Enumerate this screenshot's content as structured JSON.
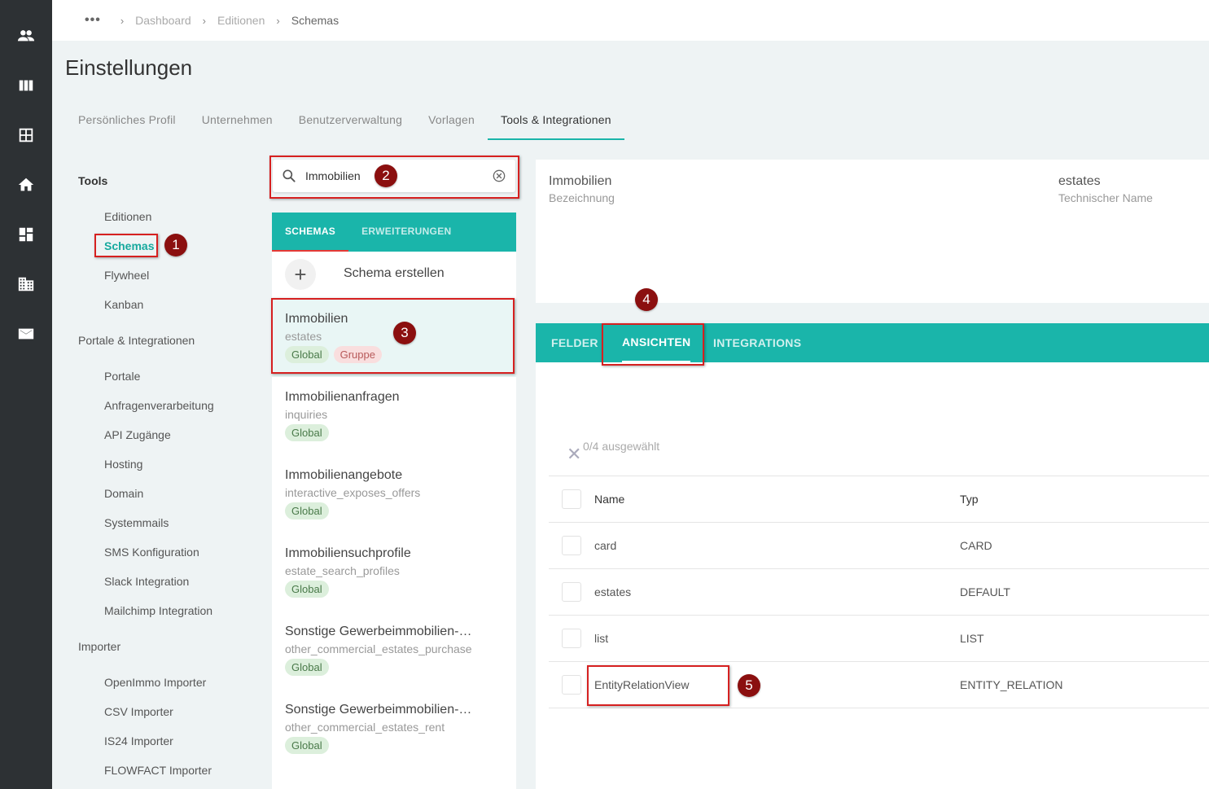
{
  "breadcrumb": {
    "more": "•••",
    "items": [
      "Dashboard",
      "Editionen",
      "Schemas"
    ]
  },
  "page_title": "Einstellungen",
  "main_tabs": [
    {
      "label": "Persönliches Profil"
    },
    {
      "label": "Unternehmen"
    },
    {
      "label": "Benutzerverwaltung"
    },
    {
      "label": "Vorlagen"
    },
    {
      "label": "Tools & Integrationen",
      "active": true
    }
  ],
  "rail_icons": [
    "users-icon",
    "columns-icon",
    "grid-icon",
    "home-icon",
    "dashboard-icon",
    "building-icon",
    "mail-icon"
  ],
  "tools_nav": {
    "tools_heading": "Tools",
    "tools_items": [
      "Editionen",
      "Schemas",
      "Flywheel",
      "Kanban"
    ],
    "portale_heading": "Portale & Integrationen",
    "portale_items": [
      "Portale",
      "Anfragenverarbeitung",
      "API Zugänge",
      "Hosting",
      "Domain",
      "Systemmails",
      "SMS Konfiguration",
      "Slack Integration",
      "Mailchimp Integration"
    ],
    "importer_heading": "Importer",
    "importer_items": [
      "OpenImmo Importer",
      "CSV Importer",
      "IS24 Importer",
      "FLOWFACT Importer"
    ]
  },
  "search": {
    "value": "Immobilien"
  },
  "list_tabs": {
    "schemas": "SCHEMAS",
    "erweiterungen": "ERWEITERUNGEN"
  },
  "create_schema_label": "Schema erstellen",
  "schemas": [
    {
      "name": "Immobilien",
      "tech": "estates",
      "chips": [
        "Global",
        "Gruppe"
      ]
    },
    {
      "name": "Immobilienanfragen",
      "tech": "inquiries",
      "chips": [
        "Global"
      ]
    },
    {
      "name": "Immobilienangebote",
      "tech": "interactive_exposes_offers",
      "chips": [
        "Global"
      ]
    },
    {
      "name": "Immobiliensuchprofile",
      "tech": "estate_search_profiles",
      "chips": [
        "Global"
      ]
    },
    {
      "name": "Sonstige Gewerbeimmobilien-K…",
      "tech": "other_commercial_estates_purchase",
      "chips": [
        "Global"
      ]
    },
    {
      "name": "Sonstige Gewerbeimmobilien-…",
      "tech": "other_commercial_estates_rent",
      "chips": [
        "Global"
      ]
    }
  ],
  "detail": {
    "name_value": "Immobilien",
    "name_label": "Bezeichnung",
    "tech_value": "estates",
    "tech_label": "Technischer Name"
  },
  "detail_tabs": {
    "felder": "FELDER",
    "ansichten": "ANSICHTEN",
    "integrations": "INTEGRATIONS"
  },
  "selection_text": "0/4 ausgewählt",
  "views_table": {
    "headers": {
      "name": "Name",
      "type": "Typ"
    },
    "rows": [
      {
        "name": "card",
        "type": "CARD"
      },
      {
        "name": "estates",
        "type": "DEFAULT"
      },
      {
        "name": "list",
        "type": "LIST"
      },
      {
        "name": "EntityRelationView",
        "type": "ENTITY_RELATION"
      }
    ]
  },
  "annotations": [
    "1",
    "2",
    "3",
    "4",
    "5"
  ],
  "colors": {
    "accent": "#1ab5aa",
    "rail": "#2d3134",
    "annotation": "#d62020",
    "marker": "#8b0f0f"
  }
}
